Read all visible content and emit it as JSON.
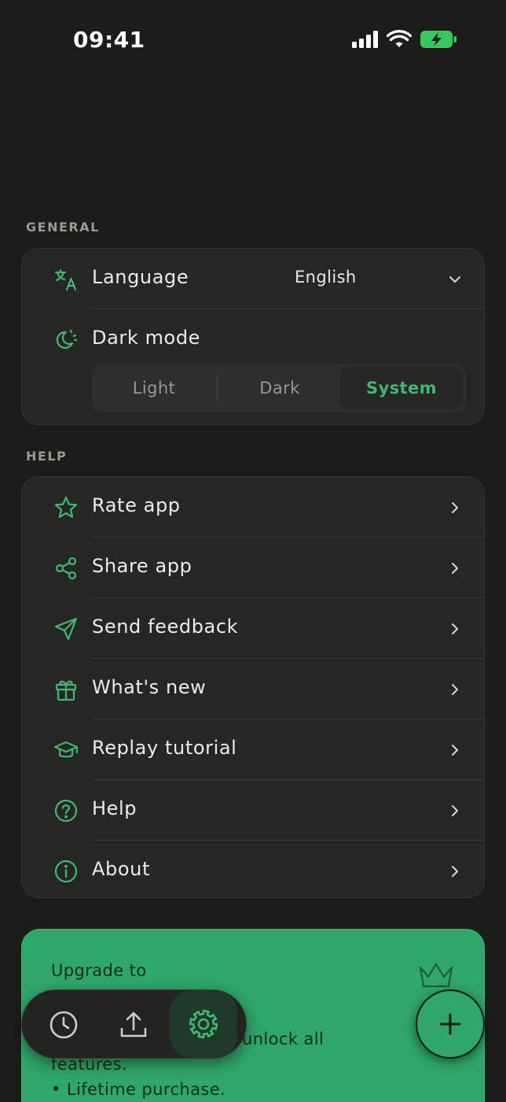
{
  "status": {
    "time": "09:41"
  },
  "general": {
    "section_label": "GENERAL",
    "language": {
      "label": "Language",
      "value": "English",
      "icon": "translate-icon"
    },
    "dark_mode": {
      "label": "Dark mode",
      "icon": "theme-icon",
      "options": [
        "Light",
        "Dark",
        "System"
      ],
      "selected": "System"
    }
  },
  "help": {
    "section_label": "HELP",
    "items": [
      {
        "label": "Rate app",
        "icon": "star-icon"
      },
      {
        "label": "Share app",
        "icon": "share-icon"
      },
      {
        "label": "Send feedback",
        "icon": "send-icon"
      },
      {
        "label": "What's new",
        "icon": "gift-icon"
      },
      {
        "label": "Replay tutorial",
        "icon": "graduation-cap-icon"
      },
      {
        "label": "Help",
        "icon": "question-icon"
      },
      {
        "label": "About",
        "icon": "info-icon"
      }
    ]
  },
  "promo": {
    "line1": "Upgrade to",
    "line2": "unlock all",
    "line3": "features.",
    "line4": "• Lifetime purchase."
  },
  "colors": {
    "accent": "#3fb871",
    "background": "#1c1c1b",
    "card": "#262624",
    "promo": "#2fa66a"
  },
  "tabbar": {
    "tabs": [
      "history-icon",
      "upload-icon",
      "settings-icon"
    ],
    "active": "settings-icon"
  }
}
